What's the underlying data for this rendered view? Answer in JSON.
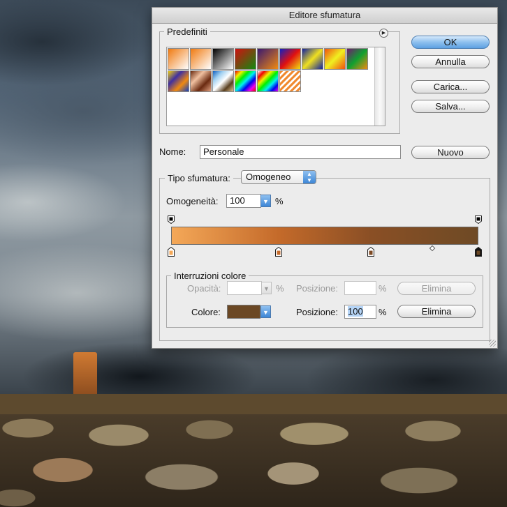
{
  "dialog": {
    "title": "Editore sfumatura"
  },
  "presets": {
    "legend": "Predefiniti",
    "swatches": [
      {
        "name": "foreground-to-background",
        "gradient": "linear-gradient(135deg,#f07a10,#ffffff)"
      },
      {
        "name": "foreground-to-transparent",
        "gradient": "linear-gradient(135deg,#f07a10,rgba(240,122,16,0))"
      },
      {
        "name": "black-white",
        "gradient": "linear-gradient(135deg,#000000,#ffffff)"
      },
      {
        "name": "red-green",
        "gradient": "linear-gradient(135deg,#d01010,#108a10)"
      },
      {
        "name": "violet-orange",
        "gradient": "linear-gradient(135deg,#3a1870,#f08a10)"
      },
      {
        "name": "blue-red-yellow",
        "gradient": "linear-gradient(135deg,#1020c0,#e01010,#f0e010)"
      },
      {
        "name": "blue-yellow-blue",
        "gradient": "linear-gradient(135deg,#1020a0,#f0e020,#1020a0)"
      },
      {
        "name": "orange-yellow-orange",
        "gradient": "linear-gradient(135deg,#f05010,#f0f020,#f05010)"
      },
      {
        "name": "violet-green-orange",
        "gradient": "linear-gradient(135deg,#701a70,#10a030,#f08a10)"
      },
      {
        "name": "yellow-violet-orange-blue",
        "gradient": "linear-gradient(135deg,#f0d010,#4030a0,#f08a10,#1040c0)"
      },
      {
        "name": "copper",
        "gradient": "linear-gradient(135deg,#6a2a10,#f0c0a0,#6a2a10,#e0a080)"
      },
      {
        "name": "chrome",
        "gradient": "linear-gradient(135deg,#1060c0,#a0d0f0,#ffffff,#5a4020,#e0c090)"
      },
      {
        "name": "spectrum",
        "gradient": "linear-gradient(135deg,#f00000,#f0f000,#00f000,#00f0f0,#0000f0,#f000f0,#f00000)"
      },
      {
        "name": "transparent-rainbow",
        "gradient": "linear-gradient(135deg,#ffffff,#f00000,#f0f000,#00f000,#00f0f0,#0000f0,#f000f0)"
      },
      {
        "name": "transparent-stripes",
        "gradient": "repeating-linear-gradient(135deg,#f08a30 0 3px,#ffffff 3px 6px)"
      }
    ]
  },
  "buttons": {
    "ok": "OK",
    "cancel": "Annulla",
    "load": "Carica...",
    "save": "Salva...",
    "new": "Nuovo",
    "delete_opacity": "Elimina",
    "delete_color": "Elimina"
  },
  "name_row": {
    "label": "Nome:",
    "value": "Personale"
  },
  "gradient_type": {
    "label": "Tipo sfumatura:",
    "selected": "Omogeneo"
  },
  "smoothness": {
    "label": "Omogeneità:",
    "value": "100",
    "unit": "%"
  },
  "gradient": {
    "css": "linear-gradient(90deg,#f4a858 0%,#c46a2a 35%,#8a4f25 65%,#6e4a25 100%)",
    "opacity_stops": [
      0,
      100
    ],
    "color_stops": [
      {
        "location": 0,
        "color": "#f4a858"
      },
      {
        "location": 35,
        "color": "#c46a2a"
      },
      {
        "location": 65,
        "color": "#7c4a24"
      },
      {
        "location": 100,
        "color": "#6b4824"
      }
    ],
    "midpoints": [
      85
    ]
  },
  "color_stops_panel": {
    "legend": "Interruzioni colore",
    "opacity_label": "Opacità:",
    "opacity_value": "",
    "opacity_unit": "%",
    "opacity_position_label": "Posizione:",
    "opacity_position_value": "",
    "opacity_position_unit": "%",
    "color_label": "Colore:",
    "color_swatch": "#6b4824",
    "color_position_label": "Posizione:",
    "color_position_value": "100",
    "color_position_unit": "%"
  },
  "icons": {
    "presets_menu": "play-arrow-icon",
    "select_arrows": "up-down-arrows-icon",
    "stepper_arrow": "down-triangle-icon",
    "resize": "resize-grip-icon"
  },
  "scene": {
    "candle_color": "#d07a32",
    "shelf_color": "#5d4a2e"
  }
}
